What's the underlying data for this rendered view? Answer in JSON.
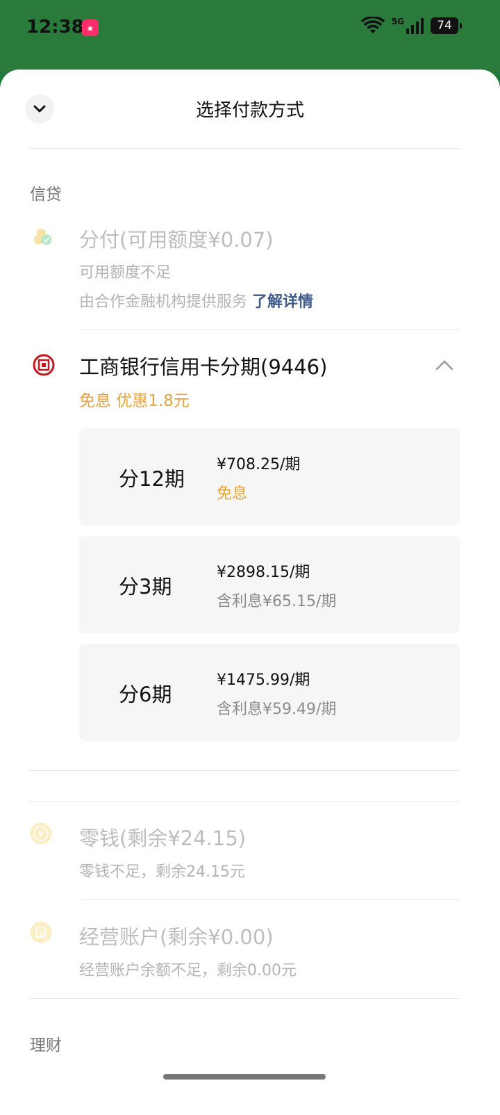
{
  "status_bar": {
    "time": "12:38",
    "battery": "74",
    "signal": "5G"
  },
  "header": {
    "title": "选择付款方式"
  },
  "sections": {
    "credit_label": "信贷",
    "finance_label": "理财"
  },
  "fenfu": {
    "name": "分付(可用额度¥0.07)",
    "status": "可用额度不足",
    "provider_text": "由合作金融机构提供服务",
    "link_text": "了解详情"
  },
  "icbc": {
    "name": "工商银行信用卡分期(9446)",
    "promo": "免息 优惠1.8元",
    "plans": [
      {
        "term": "分12期",
        "price": "¥708.25/期",
        "note": "免息"
      },
      {
        "term": "分3期",
        "price": "¥2898.15/期",
        "note": "含利息¥65.15/期"
      },
      {
        "term": "分6期",
        "price": "¥1475.99/期",
        "note": "含利息¥59.49/期"
      }
    ]
  },
  "change": {
    "name": "零钱(剩余¥24.15)",
    "status": "零钱不足，剩余24.15元"
  },
  "business": {
    "name": "经营账户(剩余¥0.00)",
    "status": "经营账户余额不足，剩余0.00元"
  },
  "colors": {
    "header_green": "#2a7a3c",
    "promo_orange": "#e8a33a",
    "link_blue": "#3d5a8a",
    "icbc_red": "#c7161e"
  }
}
